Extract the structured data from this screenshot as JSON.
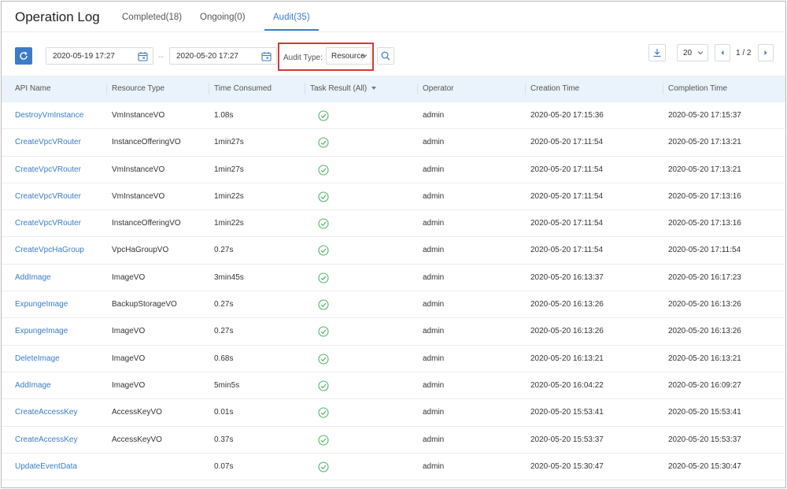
{
  "header": {
    "title": "Operation Log",
    "tabs": [
      {
        "label": "Completed(18)",
        "active": false
      },
      {
        "label": "Ongoing(0)",
        "active": false
      },
      {
        "label": "Audit(35)",
        "active": true
      }
    ]
  },
  "toolbar": {
    "refresh_icon": "refresh-icon",
    "start_date": "2020-05-19 17:27",
    "separator": "--",
    "end_date": "2020-05-20 17:27",
    "audit_type_label": "Audit Type:",
    "audit_type_value": "Resource",
    "page_size": "20",
    "page_indicator": "1 / 2"
  },
  "colors": {
    "accent": "#3a7cc9",
    "success": "#52b66a",
    "highlight": "#d43838",
    "header_bg": "#eaf2fb"
  },
  "table": {
    "columns": [
      "API Name",
      "Resource Type",
      "Time Consumed",
      "Task Result (All)",
      "Operator",
      "Creation Time",
      "Completion Time"
    ],
    "rows": [
      {
        "api": "DestroyVmInstance",
        "resource": "VmInstanceVO",
        "time": "1.08s",
        "operator": "admin",
        "created": "2020-05-20 17:15:36",
        "completed": "2020-05-20 17:15:37"
      },
      {
        "api": "CreateVpcVRouter",
        "resource": "InstanceOfferingVO",
        "time": "1min27s",
        "operator": "admin",
        "created": "2020-05-20 17:11:54",
        "completed": "2020-05-20 17:13:21"
      },
      {
        "api": "CreateVpcVRouter",
        "resource": "VmInstanceVO",
        "time": "1min27s",
        "operator": "admin",
        "created": "2020-05-20 17:11:54",
        "completed": "2020-05-20 17:13:21"
      },
      {
        "api": "CreateVpcVRouter",
        "resource": "VmInstanceVO",
        "time": "1min22s",
        "operator": "admin",
        "created": "2020-05-20 17:11:54",
        "completed": "2020-05-20 17:13:16"
      },
      {
        "api": "CreateVpcVRouter",
        "resource": "InstanceOfferingVO",
        "time": "1min22s",
        "operator": "admin",
        "created": "2020-05-20 17:11:54",
        "completed": "2020-05-20 17:13:16"
      },
      {
        "api": "CreateVpcHaGroup",
        "resource": "VpcHaGroupVO",
        "time": "0.27s",
        "operator": "admin",
        "created": "2020-05-20 17:11:54",
        "completed": "2020-05-20 17:11:54"
      },
      {
        "api": "AddImage",
        "resource": "ImageVO",
        "time": "3min45s",
        "operator": "admin",
        "created": "2020-05-20 16:13:37",
        "completed": "2020-05-20 16:17:23"
      },
      {
        "api": "ExpungeImage",
        "resource": "BackupStorageVO",
        "time": "0.27s",
        "operator": "admin",
        "created": "2020-05-20 16:13:26",
        "completed": "2020-05-20 16:13:26"
      },
      {
        "api": "ExpungeImage",
        "resource": "ImageVO",
        "time": "0.27s",
        "operator": "admin",
        "created": "2020-05-20 16:13:26",
        "completed": "2020-05-20 16:13:26"
      },
      {
        "api": "DeleteImage",
        "resource": "ImageVO",
        "time": "0.68s",
        "operator": "admin",
        "created": "2020-05-20 16:13:21",
        "completed": "2020-05-20 16:13:21"
      },
      {
        "api": "AddImage",
        "resource": "ImageVO",
        "time": "5min5s",
        "operator": "admin",
        "created": "2020-05-20 16:04:22",
        "completed": "2020-05-20 16:09:27"
      },
      {
        "api": "CreateAccessKey",
        "resource": "AccessKeyVO",
        "time": "0.01s",
        "operator": "admin",
        "created": "2020-05-20 15:53:41",
        "completed": "2020-05-20 15:53:41"
      },
      {
        "api": "CreateAccessKey",
        "resource": "AccessKeyVO",
        "time": "0.37s",
        "operator": "admin",
        "created": "2020-05-20 15:53:37",
        "completed": "2020-05-20 15:53:37"
      },
      {
        "api": "UpdateEventData",
        "resource": "",
        "time": "0.07s",
        "operator": "admin",
        "created": "2020-05-20 15:30:47",
        "completed": "2020-05-20 15:30:47"
      }
    ]
  }
}
